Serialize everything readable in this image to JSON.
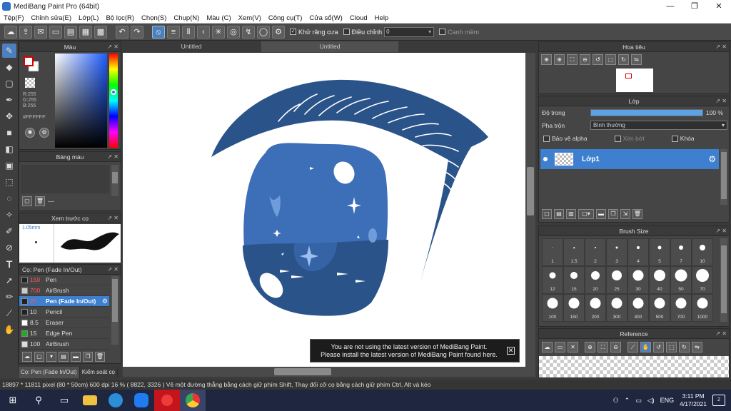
{
  "window": {
    "title": "MediBang Paint Pro (64bit)",
    "controls": [
      "—",
      "❐",
      "✕"
    ]
  },
  "menu": [
    "Tệp(F)",
    "Chỉnh sửa(E)",
    "Lớp(L)",
    "Bộ lọc(R)",
    "Chọn(S)",
    "Chụp(N)",
    "Màu (C)",
    "Xem(V)",
    "Công cụ(T)",
    "Cửa sổ(W)",
    "Cloud",
    "Help"
  ],
  "toolbar": {
    "antialias_label": "Khử răng cưa",
    "adjust_label": "Điều chỉnh",
    "adjust_value": "0",
    "snap_label": "Canh mềm"
  },
  "color_panel": {
    "title": "Màu",
    "r": "R:255",
    "g": "G:255",
    "b": "B:255",
    "hex": "#FFFFFF"
  },
  "palette_panel": {
    "title": "Bảng màu",
    "footer_text": "---"
  },
  "preview_panel": {
    "title": "Xem trước cọ",
    "size": "1.05mm"
  },
  "brush_panel": {
    "title": "Cọ: Pen (Fade In/Out)",
    "items": [
      {
        "size": "150",
        "name": "Pen",
        "color": "#222222",
        "red": true
      },
      {
        "size": "700",
        "name": "AirBrush",
        "color": "#cccccc",
        "red": true
      },
      {
        "size": "25",
        "name": "Pen (Fade In/Out)",
        "color": "#222222",
        "red": true,
        "selected": true
      },
      {
        "size": "10",
        "name": "Pencil",
        "color": "#222222",
        "red": false
      },
      {
        "size": "8.5",
        "name": "Eraser",
        "color": "#ffffff",
        "red": false
      },
      {
        "size": "15",
        "name": "Edge Pen",
        "color": "#22aa22",
        "red": false
      },
      {
        "size": "100",
        "name": "AirBrush",
        "color": "#dddddd",
        "red": false
      }
    ]
  },
  "left_tabs": [
    "Cọ: Pen (Fade In/Out)",
    "Kiểm soát cọ"
  ],
  "doc_tabs": [
    "Untitled",
    "Untitled"
  ],
  "notice": {
    "line1": "You are not using the latest version of MediBang Paint.",
    "line2": "Please install the latest version of MediBang Paint found here."
  },
  "navigator": {
    "title": "Hoa tiêu"
  },
  "layer_panel": {
    "title": "Lớp",
    "opacity_label": "Độ trong",
    "opacity_value": "100 %",
    "opacity_fraction": 1.0,
    "blend_label": "Pha trộn",
    "blend_value": "Bình thường",
    "protect_alpha": "Bảo vệ alpha",
    "clipping": "Xén bớt",
    "lock": "Khóa",
    "layer_name": "Lớp1"
  },
  "brush_size_panel": {
    "title": "Brush Size",
    "sizes": [
      "1",
      "1.5",
      "2",
      "3",
      "4",
      "5",
      "7",
      "10",
      "12",
      "15",
      "20",
      "25",
      "30",
      "40",
      "50",
      "70",
      "100",
      "150",
      "200",
      "300",
      "400",
      "500",
      "700",
      "1000"
    ]
  },
  "reference_panel": {
    "title": "Reference"
  },
  "status": "18897 * 11811 pixel  (80 * 50cm)  600 dpi  16 %  ( 8822, 3326 )  Vẽ một đường thẳng bằng cách giữ phím Shift, Thay đổi cỡ cọ bằng cách giữ phím Ctrl, Alt và kéo",
  "taskbar": {
    "lang": "ENG",
    "time": "3:11 PM",
    "date": "4/17/2021",
    "notifications": "2"
  },
  "colors": {
    "accent": "#3e7fd0",
    "eye_dark": "#2a5389",
    "eye_mid": "#3d6eb8",
    "eye_light": "#6f9ddc"
  }
}
